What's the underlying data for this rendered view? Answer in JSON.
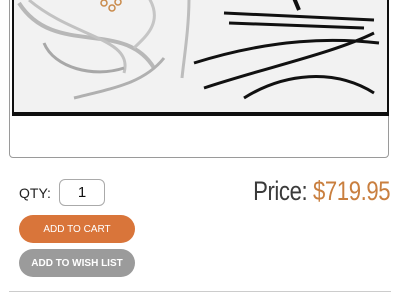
{
  "product": {
    "image_alt_icon": "cable-kit-photo",
    "quantity_label": "QTY:",
    "quantity_value": "1",
    "price_label": "Price:",
    "price_value": "$719.95"
  },
  "actions": {
    "add_to_cart": "ADD TO CART",
    "add_to_wish_list": "ADD TO WISH LIST"
  },
  "colors": {
    "price_accent": "#c97f3f",
    "cart_button": "#d9753a",
    "wish_button": "#9b9b9b"
  }
}
